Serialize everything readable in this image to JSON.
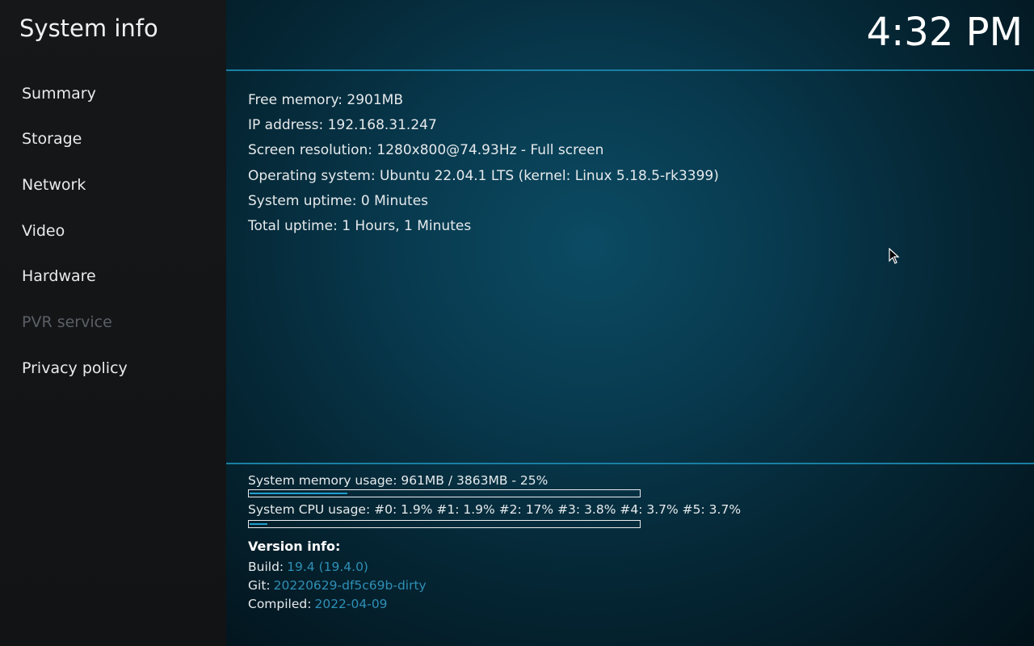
{
  "app": {
    "title": "System info"
  },
  "clock": "4:32 PM",
  "sidebar": {
    "items": [
      {
        "label": "Summary",
        "enabled": true
      },
      {
        "label": "Storage",
        "enabled": true
      },
      {
        "label": "Network",
        "enabled": true
      },
      {
        "label": "Video",
        "enabled": true
      },
      {
        "label": "Hardware",
        "enabled": true
      },
      {
        "label": "PVR service",
        "enabled": false
      },
      {
        "label": "Privacy policy",
        "enabled": true
      }
    ]
  },
  "summary": {
    "lines": [
      "Free memory: 2901MB",
      "IP address: 192.168.31.247",
      "Screen resolution: 1280x800@74.93Hz - Full screen",
      "Operating system: Ubuntu 22.04.1 LTS (kernel: Linux 5.18.5-rk3399)",
      "System uptime: 0 Minutes",
      "Total uptime: 1 Hours, 1 Minutes"
    ]
  },
  "usage": {
    "memory": {
      "label": "System memory usage: 961MB / 3863MB - 25%",
      "percent": 25
    },
    "cpu": {
      "label": "System CPU usage: #0: 1.9% #1: 1.9% #2:  17% #3: 3.8% #4: 3.7% #5: 3.7%",
      "percent": 4.5
    }
  },
  "version": {
    "title": "Version info:",
    "build_label": "Build:",
    "build_value": "19.4 (19.4.0)",
    "git_label": "Git:",
    "git_value": "20220629-df5c69b-dirty",
    "compiled_label": "Compiled:",
    "compiled_value": "2022-04-09"
  },
  "colors": {
    "accent": "#1f9fd0",
    "link": "#2f8fb6",
    "sidebar_bg": "#141618",
    "disabled": "#5a6066"
  }
}
